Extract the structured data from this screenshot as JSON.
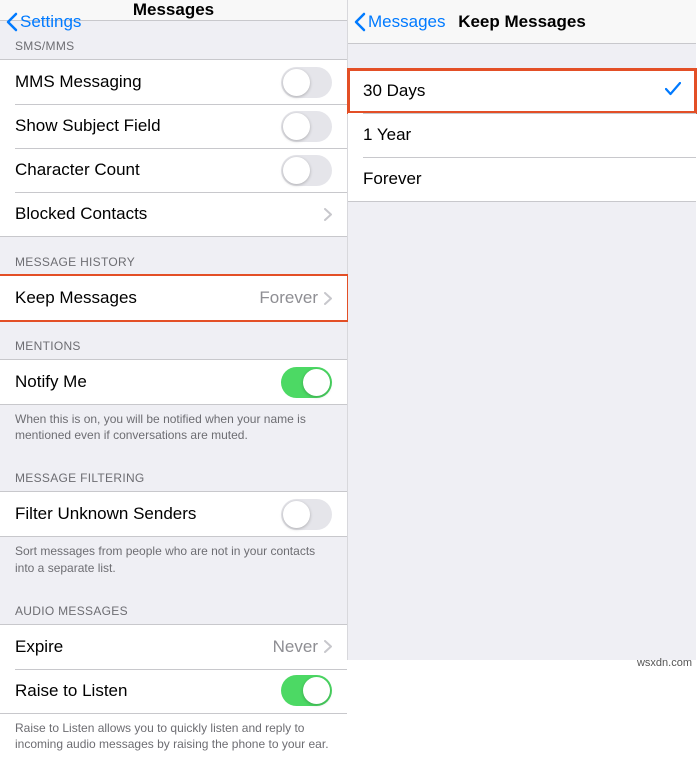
{
  "left": {
    "back_label": "Settings",
    "title": "Messages",
    "sms_header": "SMS/MMS",
    "mms_label": "MMS Messaging",
    "subject_label": "Show Subject Field",
    "charcount_label": "Character Count",
    "blocked_label": "Blocked Contacts",
    "history_header": "MESSAGE HISTORY",
    "keep_label": "Keep Messages",
    "keep_value": "Forever",
    "mentions_header": "MENTIONS",
    "notify_label": "Notify Me",
    "notify_footer": "When this is on, you will be notified when your name is mentioned even if conversations are muted.",
    "filter_header": "MESSAGE FILTERING",
    "filter_label": "Filter Unknown Senders",
    "filter_footer": "Sort messages from people who are not in your contacts into a separate list.",
    "audio_header": "AUDIO MESSAGES",
    "expire_label": "Expire",
    "expire_value": "Never",
    "raise_label": "Raise to Listen",
    "raise_footer": "Raise to Listen allows you to quickly listen and reply to incoming audio messages by raising the phone to your ear."
  },
  "right": {
    "back_label": "Messages",
    "title": "Keep Messages",
    "option_30d": "30 Days",
    "option_1y": "1 Year",
    "option_forever": "Forever",
    "selected": "30 Days"
  },
  "watermark": "wsxdn.com"
}
